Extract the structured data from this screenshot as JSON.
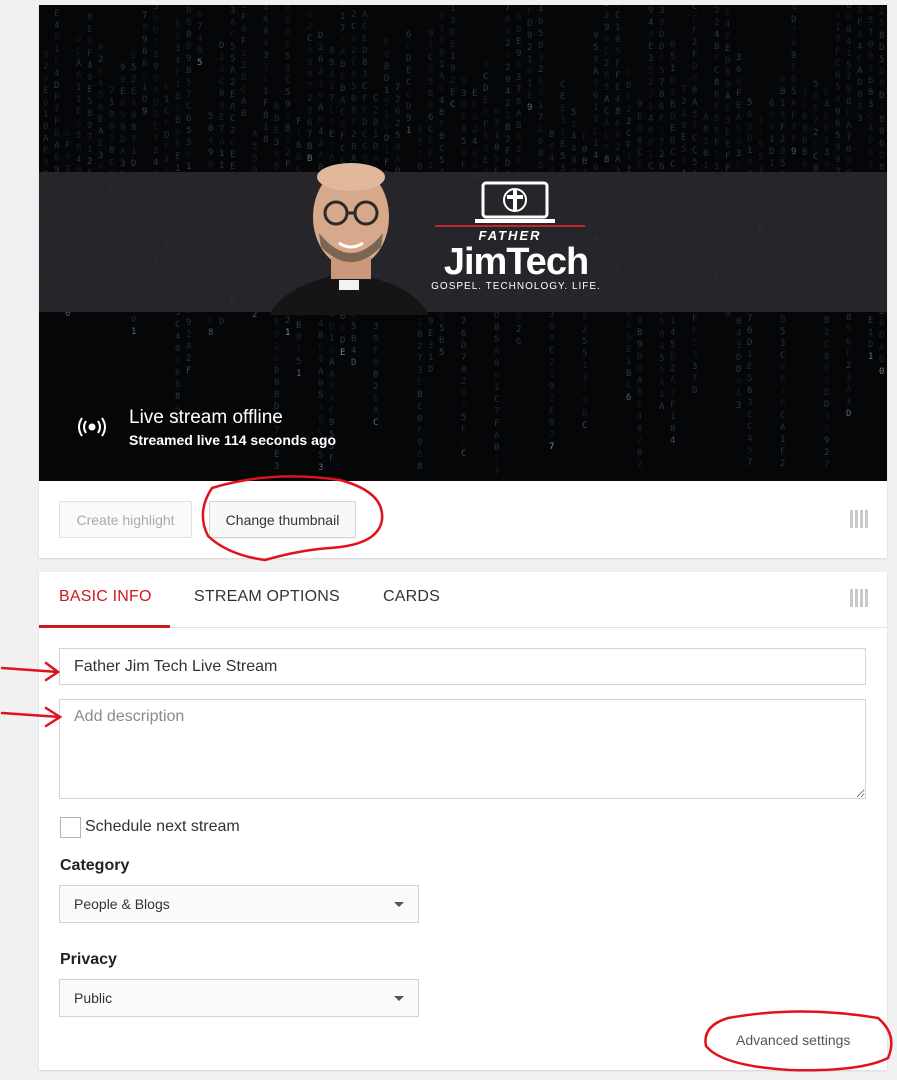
{
  "video": {
    "brand": {
      "father": "FATHER",
      "name": "JimTech",
      "tagline": "GOSPEL. TECHNOLOGY. LIFE."
    },
    "status_title": "Live stream offline",
    "status_subtitle": "Streamed live 114 seconds ago"
  },
  "actions": {
    "create_highlight": "Create highlight",
    "change_thumbnail": "Change thumbnail"
  },
  "tabs": [
    {
      "label": "BASIC INFO",
      "active": true
    },
    {
      "label": "STREAM OPTIONS",
      "active": false
    },
    {
      "label": "CARDS",
      "active": false
    }
  ],
  "form": {
    "title_value": "Father Jim Tech Live Stream",
    "description_placeholder": "Add description",
    "schedule_label": "Schedule next stream",
    "category_label": "Category",
    "category_value": "People & Blogs",
    "privacy_label": "Privacy",
    "privacy_value": "Public",
    "advanced_settings": "Advanced settings"
  },
  "colors": {
    "accent": "#cc181e",
    "annotation": "#e0121b"
  }
}
